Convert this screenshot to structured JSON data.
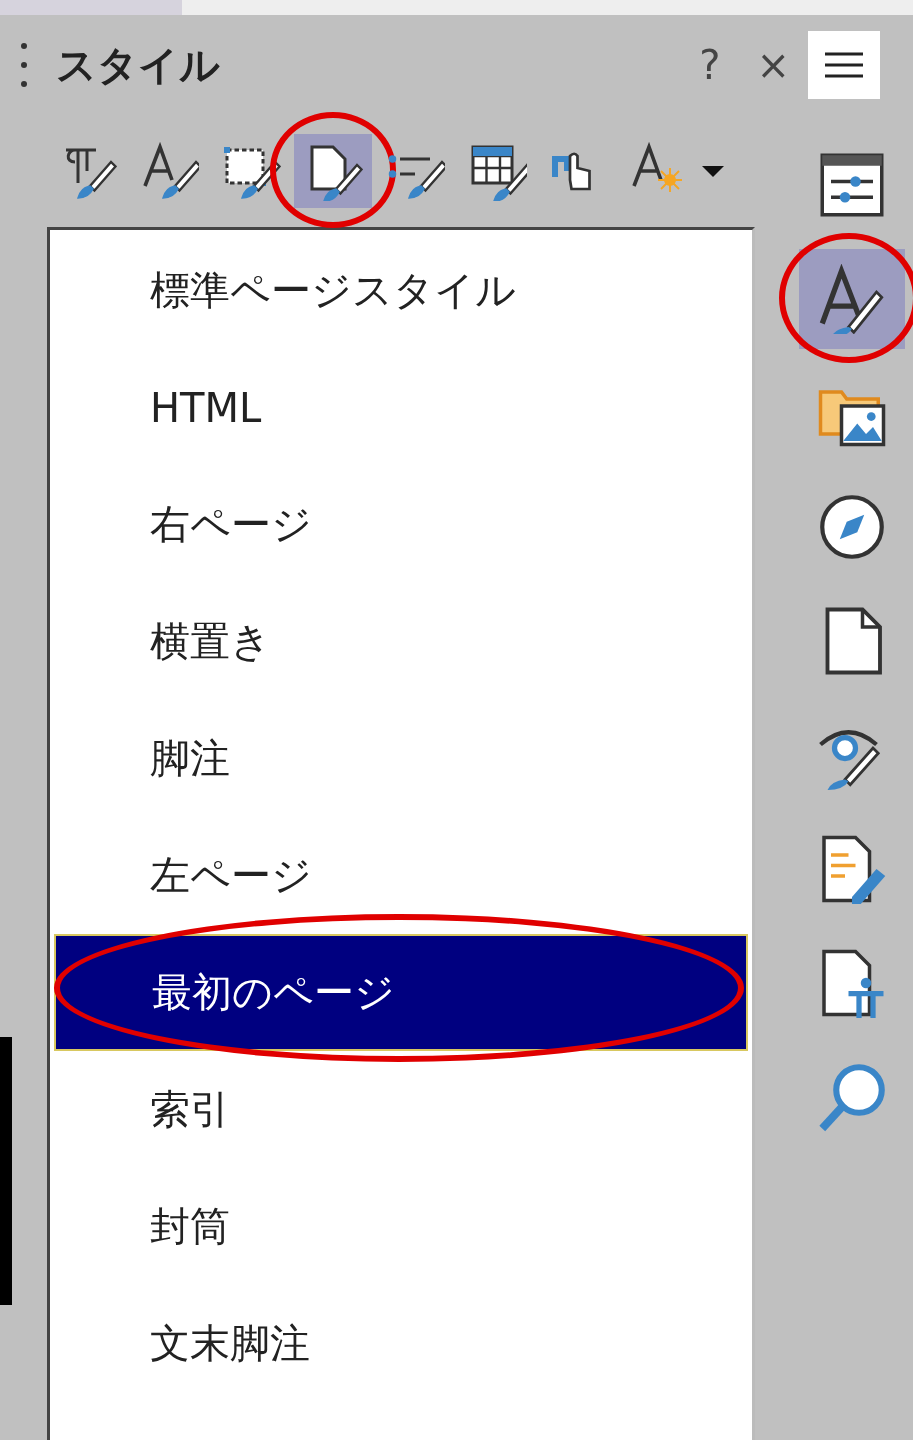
{
  "panel": {
    "title": "スタイル",
    "help": "?",
    "close": "×"
  },
  "toolbar": [
    {
      "kind": "paragraph",
      "selected": false,
      "circled": false
    },
    {
      "kind": "character",
      "selected": false,
      "circled": false
    },
    {
      "kind": "frame",
      "selected": false,
      "circled": false
    },
    {
      "kind": "page",
      "selected": true,
      "circled": true
    },
    {
      "kind": "list",
      "selected": false,
      "circled": false
    },
    {
      "kind": "table",
      "selected": false,
      "circled": false
    },
    {
      "kind": "fill",
      "selected": false,
      "circled": false
    },
    {
      "kind": "new",
      "selected": false,
      "circled": false
    }
  ],
  "styles": [
    {
      "label": "標準ページスタイル",
      "selected": false,
      "circled": false
    },
    {
      "label": "HTML",
      "selected": false,
      "circled": false
    },
    {
      "label": "右ページ",
      "selected": false,
      "circled": false
    },
    {
      "label": "横置き",
      "selected": false,
      "circled": false
    },
    {
      "label": "脚注",
      "selected": false,
      "circled": false
    },
    {
      "label": "左ページ",
      "selected": false,
      "circled": false
    },
    {
      "label": "最初のページ",
      "selected": true,
      "circled": true
    },
    {
      "label": "索引",
      "selected": false,
      "circled": false
    },
    {
      "label": "封筒",
      "selected": false,
      "circled": false
    },
    {
      "label": "文末脚注",
      "selected": false,
      "circled": false
    }
  ],
  "sidebar": [
    {
      "kind": "properties",
      "selected": false,
      "circled": false
    },
    {
      "kind": "styles",
      "selected": true,
      "circled": true
    },
    {
      "kind": "gallery",
      "selected": false,
      "circled": false
    },
    {
      "kind": "navigator",
      "selected": false,
      "circled": false
    },
    {
      "kind": "page",
      "selected": false,
      "circled": false
    },
    {
      "kind": "inspector",
      "selected": false,
      "circled": false
    },
    {
      "kind": "manage-changes",
      "selected": false,
      "circled": false
    },
    {
      "kind": "accessibility",
      "selected": false,
      "circled": false
    },
    {
      "kind": "find",
      "selected": false,
      "circled": false
    }
  ]
}
